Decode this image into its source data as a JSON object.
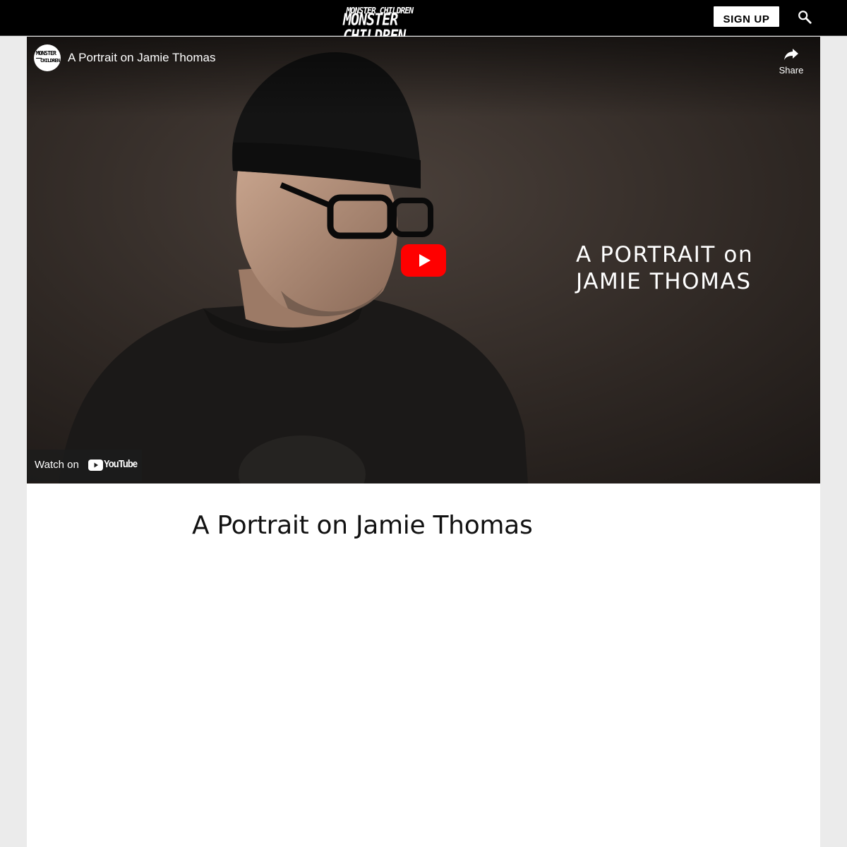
{
  "header": {
    "logo_text": "MONSTER CHILDREN",
    "signup_label": "SIGN UP",
    "search_icon": "search-icon"
  },
  "video": {
    "channel_avatar_text_top": "MONSTER",
    "channel_avatar_text_bottom": "CHILDREN",
    "title": "A Portrait on Jamie Thomas",
    "share_label": "Share",
    "overlay_line1": "A PORTRAIT on",
    "overlay_line2": "JAMIE THOMAS",
    "watch_on_label": "Watch on",
    "youtube_label": "YouTube",
    "play_icon": "play-icon",
    "colors": {
      "play_button": "#ff0000",
      "overlay_bg": "#1c1c1c"
    }
  },
  "article": {
    "title": "A Portrait on Jamie Thomas"
  }
}
